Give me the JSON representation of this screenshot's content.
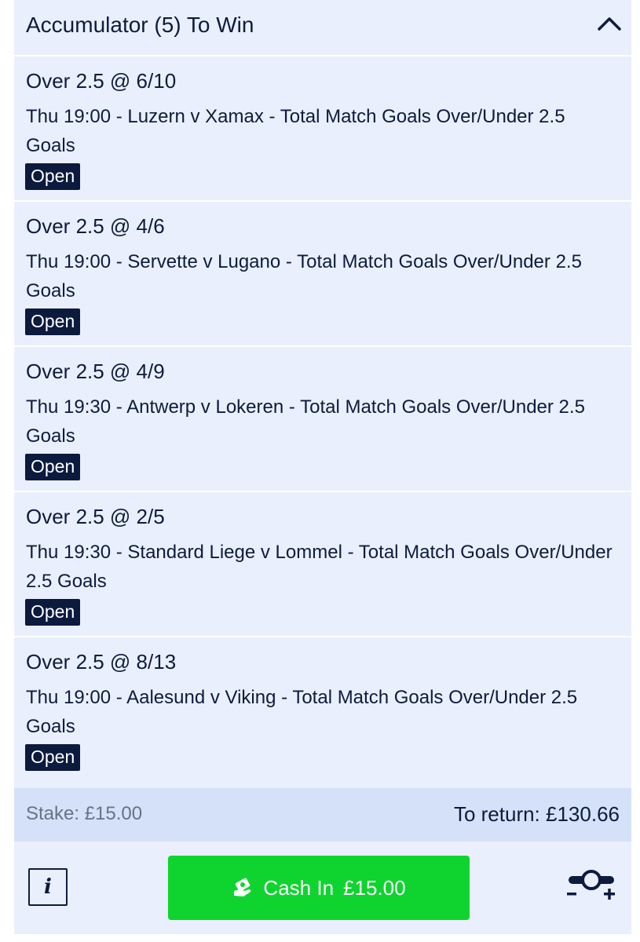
{
  "header": {
    "title": "Accumulator (5) To Win"
  },
  "legs": [
    {
      "selection": "Over 2.5 @ 6/10",
      "description": "Thu 19:00 - Luzern v Xamax - Total Match Goals Over/Under 2.5 Goals",
      "status": "Open"
    },
    {
      "selection": "Over 2.5 @ 4/6",
      "description": "Thu 19:00 - Servette v Lugano - Total Match Goals Over/Under 2.5 Goals",
      "status": "Open"
    },
    {
      "selection": "Over 2.5 @ 4/9",
      "description": "Thu 19:30 - Antwerp v Lokeren - Total Match Goals Over/Under 2.5 Goals",
      "status": "Open"
    },
    {
      "selection": "Over 2.5 @ 2/5",
      "description": "Thu 19:30 - Standard Liege v Lommel - Total Match Goals Over/Under 2.5 Goals",
      "status": "Open"
    },
    {
      "selection": "Over 2.5 @ 8/13",
      "description": "Thu 19:00 - Aalesund v Viking - Total Match Goals Over/Under 2.5 Goals",
      "status": "Open"
    }
  ],
  "summary": {
    "stake": "Stake: £15.00",
    "to_return": "To return: £130.66"
  },
  "footer": {
    "info_label": "i",
    "cash_in_label": "Cash In",
    "cash_in_amount": "£15.00",
    "icons": {
      "collapse": "chevron-up-icon",
      "info": "info-icon",
      "cash": "cash-hand-icon",
      "partial": "partial-cash-out-icon"
    }
  },
  "colors": {
    "card_bg": "#e9effc",
    "summary_bg": "#d5e1f9",
    "text_navy": "#0d1b3e",
    "badge_bg": "#0b1a3d",
    "cash_in_green": "#0fd42f"
  }
}
